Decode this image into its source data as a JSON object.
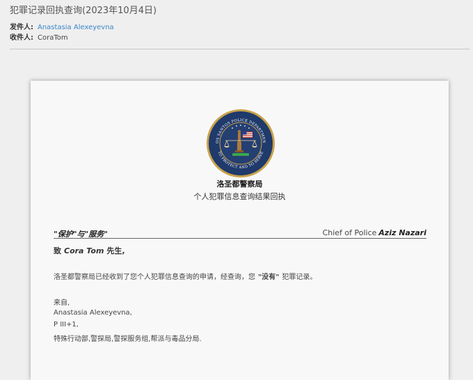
{
  "email": {
    "subject": "犯罪记录回执查询(2023年10月4日)",
    "from_label": "发件人:",
    "from_value": "Anastasia Alexeyevna",
    "to_label": "收件人:",
    "to_value": "CoraTom"
  },
  "letter": {
    "seal_text_top": "LOS SANTOS POLICE DEPARTMENT",
    "seal_text_bottom": "TO PROTECT AND TO SERVE",
    "org_name": "洛圣都警察局",
    "doc_title": "个人犯罪信息查询结果回执",
    "motto": "\"保护\"与\"服务\"",
    "chief_label": "Chief of Police",
    "chief_name": "Aziz Nazari",
    "greeting_prefix": "致",
    "greeting_name": "Cora Tom",
    "greeting_suffix": "先生,",
    "body_prefix": "洛圣都警察局已经收到了您个人犯罪信息查询的申请，经查询，您",
    "body_emphasis": "\"没有\"",
    "body_suffix": "犯罪记录。",
    "sign_from": "来自,",
    "sign_name": "Anastasia Alexeyevna,",
    "sign_rank": "P III+1,",
    "sign_unit": "特殊行动部,警探局,警探服务组,帮派与毒品分局."
  },
  "colors": {
    "link": "#3a86c8",
    "seal_blue": "#1f3a6b",
    "seal_gold": "#c9a24a"
  }
}
